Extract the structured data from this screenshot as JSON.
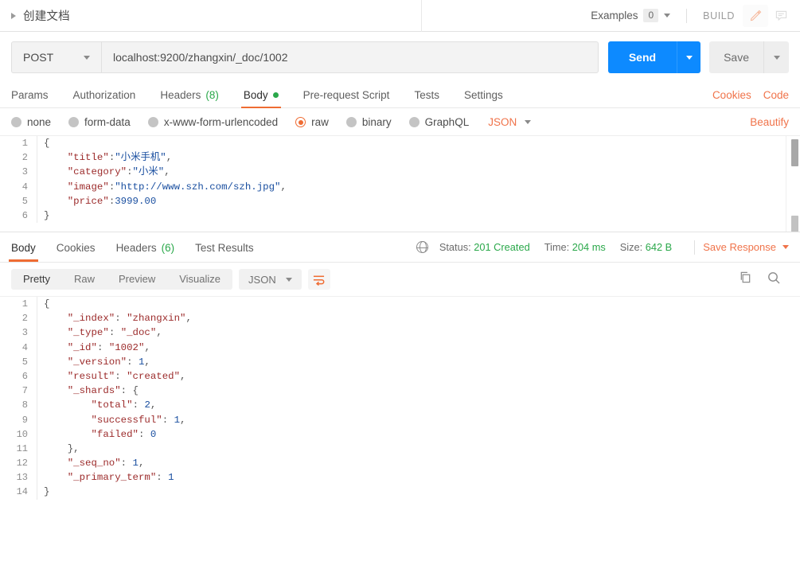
{
  "tabstrip": {
    "doc_title": "创建文档",
    "examples_label": "Examples",
    "examples_count": "0",
    "build_label": "BUILD",
    "edit_icon": "pencil-icon",
    "comment_icon": "comment-icon"
  },
  "urlbar": {
    "method": "POST",
    "url": "localhost:9200/zhangxin/_doc/1002",
    "send_label": "Send",
    "save_label": "Save"
  },
  "request_tabs": {
    "items": [
      {
        "label": "Params",
        "active": false
      },
      {
        "label": "Authorization",
        "active": false
      },
      {
        "label": "Headers",
        "count": "(8)",
        "active": false
      },
      {
        "label": "Body",
        "dot": true,
        "active": true
      },
      {
        "label": "Pre-request Script",
        "active": false
      },
      {
        "label": "Tests",
        "active": false
      },
      {
        "label": "Settings",
        "active": false
      }
    ],
    "cookies_label": "Cookies",
    "code_label": "Code"
  },
  "body_types": {
    "options": [
      {
        "label": "none",
        "selected": false
      },
      {
        "label": "form-data",
        "selected": false
      },
      {
        "label": "x-www-form-urlencoded",
        "selected": false
      },
      {
        "label": "raw",
        "selected": true
      },
      {
        "label": "binary",
        "selected": false
      },
      {
        "label": "GraphQL",
        "selected": false
      }
    ],
    "format": "JSON",
    "beautify_label": "Beautify"
  },
  "request_body": {
    "lines": [
      {
        "n": "1",
        "segs": [
          {
            "t": "{",
            "c": "tok-punc"
          }
        ]
      },
      {
        "n": "2",
        "segs": [
          {
            "t": "    ",
            "c": "tok-punc"
          },
          {
            "t": "\"title\"",
            "c": "tok-key"
          },
          {
            "t": ":",
            "c": "tok-punc"
          },
          {
            "t": "\"小米手机\"",
            "c": "tok-str"
          },
          {
            "t": ",",
            "c": "tok-punc"
          }
        ]
      },
      {
        "n": "3",
        "segs": [
          {
            "t": "    ",
            "c": "tok-punc"
          },
          {
            "t": "\"category\"",
            "c": "tok-key"
          },
          {
            "t": ":",
            "c": "tok-punc"
          },
          {
            "t": "\"小米\"",
            "c": "tok-str"
          },
          {
            "t": ",",
            "c": "tok-punc"
          }
        ]
      },
      {
        "n": "4",
        "segs": [
          {
            "t": "    ",
            "c": "tok-punc"
          },
          {
            "t": "\"image\"",
            "c": "tok-key"
          },
          {
            "t": ":",
            "c": "tok-punc"
          },
          {
            "t": "\"http://www.szh.com/szh.jpg\"",
            "c": "tok-str"
          },
          {
            "t": ",",
            "c": "tok-punc"
          }
        ]
      },
      {
        "n": "5",
        "segs": [
          {
            "t": "    ",
            "c": "tok-punc"
          },
          {
            "t": "\"price\"",
            "c": "tok-key"
          },
          {
            "t": ":",
            "c": "tok-punc"
          },
          {
            "t": "3999.00",
            "c": "tok-num"
          }
        ]
      },
      {
        "n": "6",
        "segs": [
          {
            "t": "}",
            "c": "tok-punc"
          }
        ]
      }
    ]
  },
  "response_tabs": {
    "items": [
      {
        "label": "Body",
        "active": true
      },
      {
        "label": "Cookies",
        "active": false
      },
      {
        "label": "Headers",
        "count": "(6)",
        "active": false
      },
      {
        "label": "Test Results",
        "active": false
      }
    ],
    "status_label": "Status:",
    "status_value": "201 Created",
    "time_label": "Time:",
    "time_value": "204 ms",
    "size_label": "Size:",
    "size_value": "642 B",
    "save_response_label": "Save Response",
    "globe_icon": "globe-icon"
  },
  "response_toolbar": {
    "views": [
      {
        "label": "Pretty",
        "active": true
      },
      {
        "label": "Raw",
        "active": false
      },
      {
        "label": "Preview",
        "active": false
      },
      {
        "label": "Visualize",
        "active": false
      }
    ],
    "format": "JSON",
    "wrap_icon": "word-wrap-icon",
    "copy_icon": "copy-icon",
    "search_icon": "search-icon"
  },
  "response_body": {
    "lines": [
      {
        "n": "1",
        "segs": [
          {
            "t": "{",
            "c": "tok-punc"
          }
        ]
      },
      {
        "n": "2",
        "segs": [
          {
            "t": "    ",
            "c": "tok-punc"
          },
          {
            "t": "\"_index\"",
            "c": "tok-key"
          },
          {
            "t": ": ",
            "c": "tok-punc"
          },
          {
            "t": "\"zhangxin\"",
            "c": "tok-str"
          },
          {
            "t": ",",
            "c": "tok-punc"
          }
        ]
      },
      {
        "n": "3",
        "segs": [
          {
            "t": "    ",
            "c": "tok-punc"
          },
          {
            "t": "\"_type\"",
            "c": "tok-key"
          },
          {
            "t": ": ",
            "c": "tok-punc"
          },
          {
            "t": "\"_doc\"",
            "c": "tok-str"
          },
          {
            "t": ",",
            "c": "tok-punc"
          }
        ]
      },
      {
        "n": "4",
        "segs": [
          {
            "t": "    ",
            "c": "tok-punc"
          },
          {
            "t": "\"_id\"",
            "c": "tok-key"
          },
          {
            "t": ": ",
            "c": "tok-punc"
          },
          {
            "t": "\"1002\"",
            "c": "tok-str"
          },
          {
            "t": ",",
            "c": "tok-punc"
          }
        ]
      },
      {
        "n": "5",
        "segs": [
          {
            "t": "    ",
            "c": "tok-punc"
          },
          {
            "t": "\"_version\"",
            "c": "tok-key"
          },
          {
            "t": ": ",
            "c": "tok-punc"
          },
          {
            "t": "1",
            "c": "tok-num"
          },
          {
            "t": ",",
            "c": "tok-punc"
          }
        ]
      },
      {
        "n": "6",
        "segs": [
          {
            "t": "    ",
            "c": "tok-punc"
          },
          {
            "t": "\"result\"",
            "c": "tok-key"
          },
          {
            "t": ": ",
            "c": "tok-punc"
          },
          {
            "t": "\"created\"",
            "c": "tok-str"
          },
          {
            "t": ",",
            "c": "tok-punc"
          }
        ]
      },
      {
        "n": "7",
        "segs": [
          {
            "t": "    ",
            "c": "tok-punc"
          },
          {
            "t": "\"_shards\"",
            "c": "tok-key"
          },
          {
            "t": ": {",
            "c": "tok-punc"
          }
        ]
      },
      {
        "n": "8",
        "segs": [
          {
            "t": "        ",
            "c": "tok-punc"
          },
          {
            "t": "\"total\"",
            "c": "tok-key"
          },
          {
            "t": ": ",
            "c": "tok-punc"
          },
          {
            "t": "2",
            "c": "tok-num"
          },
          {
            "t": ",",
            "c": "tok-punc"
          }
        ]
      },
      {
        "n": "9",
        "segs": [
          {
            "t": "        ",
            "c": "tok-punc"
          },
          {
            "t": "\"successful\"",
            "c": "tok-key"
          },
          {
            "t": ": ",
            "c": "tok-punc"
          },
          {
            "t": "1",
            "c": "tok-num"
          },
          {
            "t": ",",
            "c": "tok-punc"
          }
        ]
      },
      {
        "n": "10",
        "segs": [
          {
            "t": "        ",
            "c": "tok-punc"
          },
          {
            "t": "\"failed\"",
            "c": "tok-key"
          },
          {
            "t": ": ",
            "c": "tok-punc"
          },
          {
            "t": "0",
            "c": "tok-num"
          }
        ]
      },
      {
        "n": "11",
        "segs": [
          {
            "t": "    },",
            "c": "tok-punc"
          }
        ]
      },
      {
        "n": "12",
        "segs": [
          {
            "t": "    ",
            "c": "tok-punc"
          },
          {
            "t": "\"_seq_no\"",
            "c": "tok-key"
          },
          {
            "t": ": ",
            "c": "tok-punc"
          },
          {
            "t": "1",
            "c": "tok-num"
          },
          {
            "t": ",",
            "c": "tok-punc"
          }
        ]
      },
      {
        "n": "13",
        "segs": [
          {
            "t": "    ",
            "c": "tok-punc"
          },
          {
            "t": "\"_primary_term\"",
            "c": "tok-key"
          },
          {
            "t": ": ",
            "c": "tok-punc"
          },
          {
            "t": "1",
            "c": "tok-num"
          }
        ]
      },
      {
        "n": "14",
        "segs": [
          {
            "t": "}",
            "c": "tok-punc"
          }
        ]
      }
    ]
  },
  "colors": {
    "accent_orange": "#ef6c33",
    "send_blue": "#0d8aff",
    "status_green": "#2aa84a"
  }
}
